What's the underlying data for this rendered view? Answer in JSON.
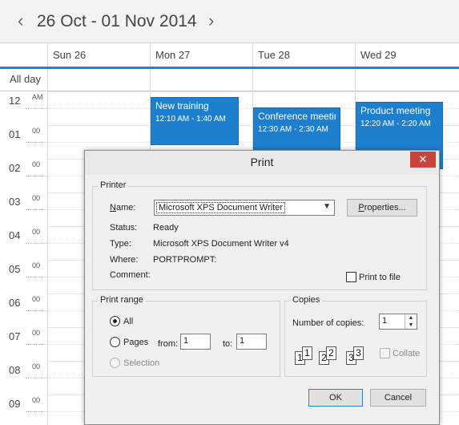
{
  "calendar": {
    "range_title": "26 Oct - 01 Nov 2014",
    "prev_label": "‹",
    "next_label": "›",
    "days": [
      "Sun 26",
      "Mon 27",
      "Tue 28",
      "Wed 29"
    ],
    "all_day_label": "All day",
    "hours": [
      {
        "hour": "12",
        "min": "AM"
      },
      {
        "hour": "01",
        "min": "00"
      },
      {
        "hour": "02",
        "min": "00"
      },
      {
        "hour": "03",
        "min": "00"
      },
      {
        "hour": "04",
        "min": "00"
      },
      {
        "hour": "05",
        "min": "00"
      },
      {
        "hour": "06",
        "min": "00"
      },
      {
        "hour": "07",
        "min": "00"
      },
      {
        "hour": "08",
        "min": "00"
      },
      {
        "hour": "09",
        "min": "00"
      }
    ],
    "events": [
      {
        "title": "New training",
        "time": "12:10 AM - 1:40 AM"
      },
      {
        "title": "Conference meeting",
        "time": "12:30 AM - 2:30 AM"
      },
      {
        "title": "Product meeting",
        "time": "12:20 AM - 2:20 AM"
      }
    ],
    "event_color": "#1f7fcf",
    "accent_color": "#1f86d6"
  },
  "dialog": {
    "title": "Print",
    "close_label": "✕",
    "printer": {
      "group_title": "Printer",
      "name_label": "Name:",
      "name_value": "Microsoft XPS Document Writer",
      "properties_label": "Properties...",
      "status_label": "Status:",
      "status_value": "Ready",
      "type_label": "Type:",
      "type_value": "Microsoft XPS Document Writer v4",
      "where_label": "Where:",
      "where_value": "PORTPROMPT:",
      "comment_label": "Comment:",
      "comment_value": "",
      "print_to_file_label": "Print to file"
    },
    "range": {
      "group_title": "Print range",
      "all_label": "All",
      "pages_label": "Pages",
      "from_label": "from:",
      "from_value": "1",
      "to_label": "to:",
      "to_value": "1",
      "selection_label": "Selection"
    },
    "copies": {
      "group_title": "Copies",
      "count_label": "Number of copies:",
      "count_value": "1",
      "collate_label": "Collate",
      "collate_pages": [
        "1",
        "1",
        "2",
        "2",
        "3",
        "3"
      ]
    },
    "ok_label": "OK",
    "cancel_label": "Cancel"
  }
}
